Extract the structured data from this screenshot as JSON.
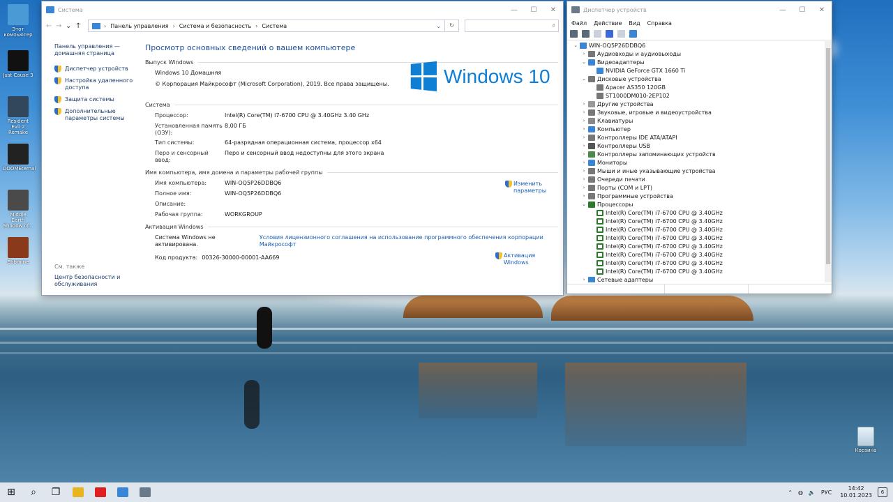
{
  "desktop": {
    "icons": [
      {
        "label": "Этот компьютер",
        "color": "#4a9ad6"
      },
      {
        "label": "Just Cause 3",
        "color": "#111111"
      },
      {
        "label": "Resident Evil 2 Remake",
        "color": "#33475c"
      },
      {
        "label": "DOOMEternal",
        "color": "#222222"
      },
      {
        "label": "Middle Earth Shadow of...",
        "color": "#4a4a4a"
      },
      {
        "label": "Ebbmine",
        "color": "#8a3a1a"
      }
    ],
    "recycle_bin": "Корзина"
  },
  "system_window": {
    "title": "Система",
    "breadcrumbs": [
      "Панель управления",
      "Система и безопасность",
      "Система"
    ],
    "left_pane": {
      "home": "Панель управления — домашняя страница",
      "links": [
        "Диспетчер устройств",
        "Настройка удаленного доступа",
        "Защита системы",
        "Дополнительные параметры системы"
      ],
      "see_also": "См. также",
      "security_center": "Центр безопасности и обслуживания"
    },
    "heading": "Просмотр основных сведений о вашем компьютере",
    "edition_section": "Выпуск Windows",
    "edition": "Windows 10 Домашняя",
    "copyright": "© Корпорация Майкрософт (Microsoft Corporation), 2019. Все права защищены.",
    "logo_text": "Windows 10",
    "system_section": "Система",
    "system_rows": [
      {
        "k": "Процессор:",
        "v": "Intel(R) Core(TM) i7-6700 CPU @ 3.40GHz   3.40 GHz"
      },
      {
        "k": "Установленная память (ОЗУ):",
        "v": "8,00 ГБ"
      },
      {
        "k": "Тип системы:",
        "v": "64-разрядная операционная система, процессор x64"
      },
      {
        "k": "Перо и сенсорный ввод:",
        "v": "Перо и сенсорный ввод недоступны для этого экрана"
      }
    ],
    "name_section": "Имя компьютера, имя домена и параметры рабочей группы",
    "name_rows": [
      {
        "k": "Имя компьютера:",
        "v": "WIN-OQ5P26DDBQ6"
      },
      {
        "k": "Полное имя:",
        "v": "WIN-OQ5P26DDBQ6"
      },
      {
        "k": "Описание:",
        "v": ""
      },
      {
        "k": "Рабочая группа:",
        "v": "WORKGROUP"
      }
    ],
    "change_settings": "Изменить параметры",
    "activation_section": "Активация Windows",
    "activation_status": "Система Windows не активирована.",
    "license_link": "Условия лицензионного соглашения на использование программного обеспечения корпорации Майкрософт",
    "product_key_label": "Код продукта:",
    "product_key": "00326-30000-00001-AA669",
    "activate_link": "Активация Windows"
  },
  "device_manager": {
    "title": "Диспетчер устройств",
    "menu": [
      "Файл",
      "Действие",
      "Вид",
      "Справка"
    ],
    "tree": [
      {
        "level": 0,
        "exp": "v",
        "label": "WIN-OQ5P26DDBQ6",
        "icon": "#3a86d6"
      },
      {
        "level": 1,
        "exp": ">",
        "label": "Аудиовходы и аудиовыходы",
        "icon": "#777777"
      },
      {
        "level": 1,
        "exp": "v",
        "label": "Видеоадаптеры",
        "icon": "#3a86d6"
      },
      {
        "level": 2,
        "exp": "",
        "label": "NVIDIA GeForce GTX 1660 Ti",
        "icon": "#3a86d6"
      },
      {
        "level": 1,
        "exp": "v",
        "label": "Дисковые устройства",
        "icon": "#777777"
      },
      {
        "level": 2,
        "exp": "",
        "label": "Apacer AS350 120GB",
        "icon": "#777777"
      },
      {
        "level": 2,
        "exp": "",
        "label": "ST1000DM010-2EP102",
        "icon": "#777777"
      },
      {
        "level": 1,
        "exp": ">",
        "label": "Другие устройства",
        "icon": "#999999"
      },
      {
        "level": 1,
        "exp": ">",
        "label": "Звуковые, игровые и видеоустройства",
        "icon": "#777777"
      },
      {
        "level": 1,
        "exp": ">",
        "label": "Клавиатуры",
        "icon": "#888888"
      },
      {
        "level": 1,
        "exp": ">",
        "label": "Компьютер",
        "icon": "#3a86d6"
      },
      {
        "level": 1,
        "exp": ">",
        "label": "Контроллеры IDE ATA/ATAPI",
        "icon": "#777777"
      },
      {
        "level": 1,
        "exp": ">",
        "label": "Контроллеры USB",
        "icon": "#555555"
      },
      {
        "level": 1,
        "exp": ">",
        "label": "Контроллеры запоминающих устройств",
        "icon": "#4a8a4a"
      },
      {
        "level": 1,
        "exp": ">",
        "label": "Мониторы",
        "icon": "#3a86d6"
      },
      {
        "level": 1,
        "exp": ">",
        "label": "Мыши и иные указывающие устройства",
        "icon": "#777777"
      },
      {
        "level": 1,
        "exp": ">",
        "label": "Очереди печати",
        "icon": "#777777"
      },
      {
        "level": 1,
        "exp": ">",
        "label": "Порты (COM и LPT)",
        "icon": "#777777"
      },
      {
        "level": 1,
        "exp": ">",
        "label": "Программные устройства",
        "icon": "#777777"
      },
      {
        "level": 1,
        "exp": "v",
        "label": "Процессоры",
        "icon": "#2a7a2a"
      },
      {
        "level": 2,
        "exp": "",
        "label": "Intel(R) Core(TM) i7-6700 CPU @ 3.40GHz",
        "icon": "cpu"
      },
      {
        "level": 2,
        "exp": "",
        "label": "Intel(R) Core(TM) i7-6700 CPU @ 3.40GHz",
        "icon": "cpu"
      },
      {
        "level": 2,
        "exp": "",
        "label": "Intel(R) Core(TM) i7-6700 CPU @ 3.40GHz",
        "icon": "cpu"
      },
      {
        "level": 2,
        "exp": "",
        "label": "Intel(R) Core(TM) i7-6700 CPU @ 3.40GHz",
        "icon": "cpu"
      },
      {
        "level": 2,
        "exp": "",
        "label": "Intel(R) Core(TM) i7-6700 CPU @ 3.40GHz",
        "icon": "cpu"
      },
      {
        "level": 2,
        "exp": "",
        "label": "Intel(R) Core(TM) i7-6700 CPU @ 3.40GHz",
        "icon": "cpu"
      },
      {
        "level": 2,
        "exp": "",
        "label": "Intel(R) Core(TM) i7-6700 CPU @ 3.40GHz",
        "icon": "cpu"
      },
      {
        "level": 2,
        "exp": "",
        "label": "Intel(R) Core(TM) i7-6700 CPU @ 3.40GHz",
        "icon": "cpu"
      },
      {
        "level": 1,
        "exp": ">",
        "label": "Сетевые адаптеры",
        "icon": "#3a86d6"
      }
    ]
  },
  "taskbar": {
    "apps": [
      {
        "name": "start-icon",
        "color": "#111111"
      },
      {
        "name": "search-icon",
        "color": "#111111"
      },
      {
        "name": "task-view-icon",
        "color": "#111111"
      },
      {
        "name": "file-explorer-icon",
        "color": "#e8b420"
      },
      {
        "name": "yandex-browser-icon",
        "color": "#e02020"
      },
      {
        "name": "control-panel-icon",
        "color": "#3a86d6"
      },
      {
        "name": "device-manager-icon",
        "color": "#6a7a8a"
      }
    ],
    "language": "РУС",
    "time": "14:42",
    "date": "10.01.2023",
    "notifications": "6"
  }
}
